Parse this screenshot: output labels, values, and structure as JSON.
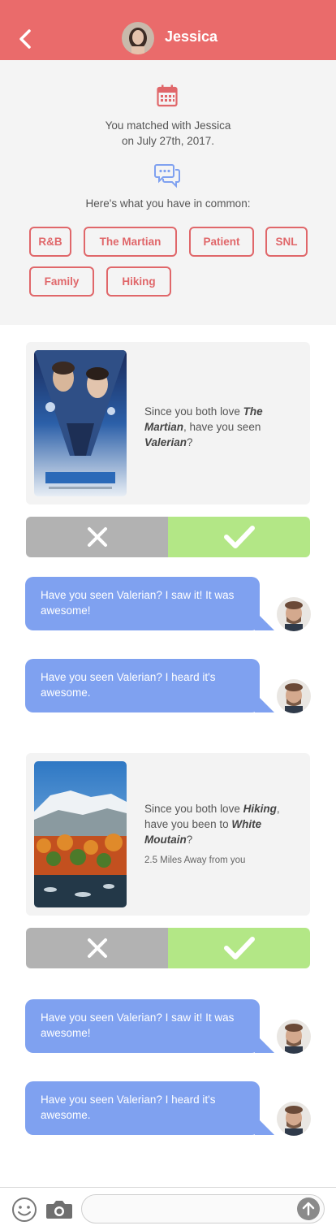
{
  "header": {
    "title": "Jessica"
  },
  "match": {
    "line1": "You matched with Jessica",
    "line2": "on July 27th, 2017.",
    "common_label": "Here's what you have in common:",
    "tags": [
      "R&B",
      "The Martian",
      "Patient",
      "SNL",
      "Family",
      "Hiking"
    ]
  },
  "suggestions": [
    {
      "pre": "Since you both love ",
      "topic": "The Martian",
      "mid": ", have you seen ",
      "target": "Valerian",
      "post": "?",
      "image": "valerian-movie-poster",
      "distance": ""
    },
    {
      "pre": "Since you both love ",
      "topic": "Hiking",
      "mid": ", have you been to ",
      "target": "White Moutain",
      "post": "?",
      "image": "white-mountain-photo",
      "distance": "2.5 Miles Away from you"
    }
  ],
  "messages": [
    {
      "text": "Have you seen Valerian? I saw it! It was awesome!"
    },
    {
      "text": "Have you seen Valerian? I heard it's awesome."
    },
    {
      "text": "Have you seen Valerian? I saw it! It was awesome!"
    },
    {
      "text": "Have you seen Valerian? I heard it's awesome."
    }
  ],
  "icons": {
    "back": "chevron-left-icon",
    "calendar": "calendar-icon",
    "chat": "chat-bubbles-icon",
    "reject": "x-icon",
    "accept": "check-icon",
    "emoji": "emoji-icon",
    "camera": "camera-icon",
    "send": "arrow-up-icon"
  },
  "colors": {
    "accent": "#ea6b6b",
    "tag": "#e0676a",
    "bubble": "#7fa1f0",
    "accept": "#b3e786",
    "reject": "#b2b2b2"
  }
}
